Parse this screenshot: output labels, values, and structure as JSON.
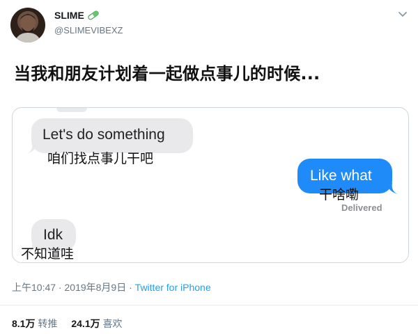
{
  "user": {
    "display_name": "SLIME",
    "handle": "@SLIMEVIBEXZ",
    "name_emoji": "pill-emoji"
  },
  "tweet": {
    "text": "当我和朋友计划着一起做点事儿的时候..."
  },
  "conversation": {
    "messages": [
      {
        "side": "received",
        "text": "Let's do something",
        "translation": "咱们找点事儿干吧"
      },
      {
        "side": "sent",
        "text": "Like what",
        "translation": "干啥嘞",
        "status": "Delivered"
      },
      {
        "side": "received",
        "text": "Idk",
        "translation": "不知道哇"
      }
    ],
    "colors": {
      "received_bubble": "#e9e9eb",
      "sent_bubble": "#1e8bf9"
    }
  },
  "meta": {
    "time": "上午10:47",
    "separator": " · ",
    "date": "2019年8月9日",
    "source": "Twitter for iPhone"
  },
  "stats": {
    "retweets_count": "8.1万",
    "retweets_label": "转推",
    "likes_count": "24.1万",
    "likes_label": "喜欢"
  },
  "icons": {
    "menu": "chevron-down-icon",
    "link": "#1da1f2"
  }
}
